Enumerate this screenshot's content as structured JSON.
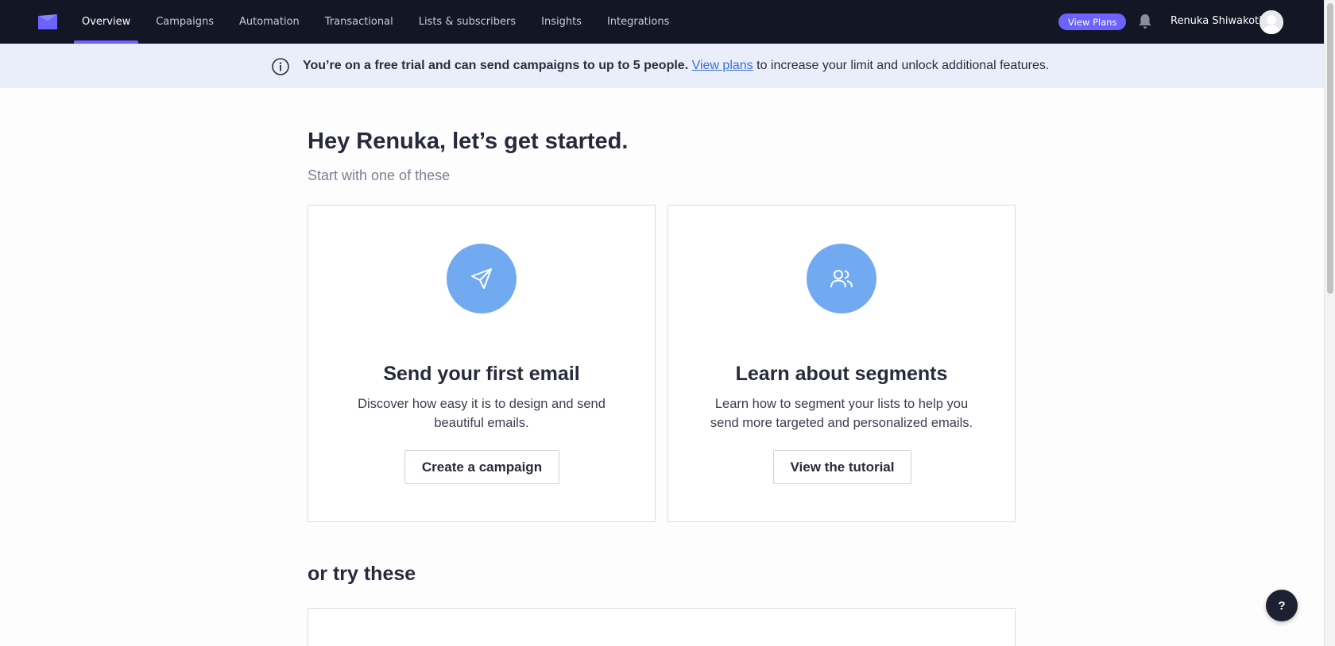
{
  "nav": {
    "items": [
      {
        "label": "Overview",
        "active": true
      },
      {
        "label": "Campaigns",
        "active": false
      },
      {
        "label": "Automation",
        "active": false
      },
      {
        "label": "Transactional",
        "active": false
      },
      {
        "label": "Lists & subscribers",
        "active": false
      },
      {
        "label": "Insights",
        "active": false
      },
      {
        "label": "Integrations",
        "active": false
      }
    ],
    "view_plans_label": "View Plans",
    "user_name": "Renuka Shiwakoti",
    "logo_icon": "mailersend-logo-icon",
    "bell_icon": "bell-icon"
  },
  "banner": {
    "bold_text": "You’re on a free trial and can send campaigns to up to 5 people.",
    "link_text": "View plans",
    "rest_text": " to increase your limit and unlock additional features.",
    "icon": "info-icon"
  },
  "main": {
    "heading": "Hey Renuka, let’s get started.",
    "subheading": "Start with one of these",
    "cards": [
      {
        "icon": "send-icon",
        "title": "Send your first email",
        "description": "Discover how easy it is to design and send beautiful emails.",
        "button": "Create a campaign"
      },
      {
        "icon": "users-icon",
        "title": "Learn about segments",
        "description": "Learn how to segment your lists to help you send more targeted and personalized emails.",
        "button": "View the tutorial"
      }
    ],
    "try_heading": "or try these"
  },
  "help": {
    "label": "?"
  },
  "colors": {
    "nav_bg": "#131625",
    "accent": "#6c63ff",
    "banner_bg": "#eaedfa",
    "card_icon_bg": "#72aaf1",
    "link": "#3a6fd8"
  }
}
